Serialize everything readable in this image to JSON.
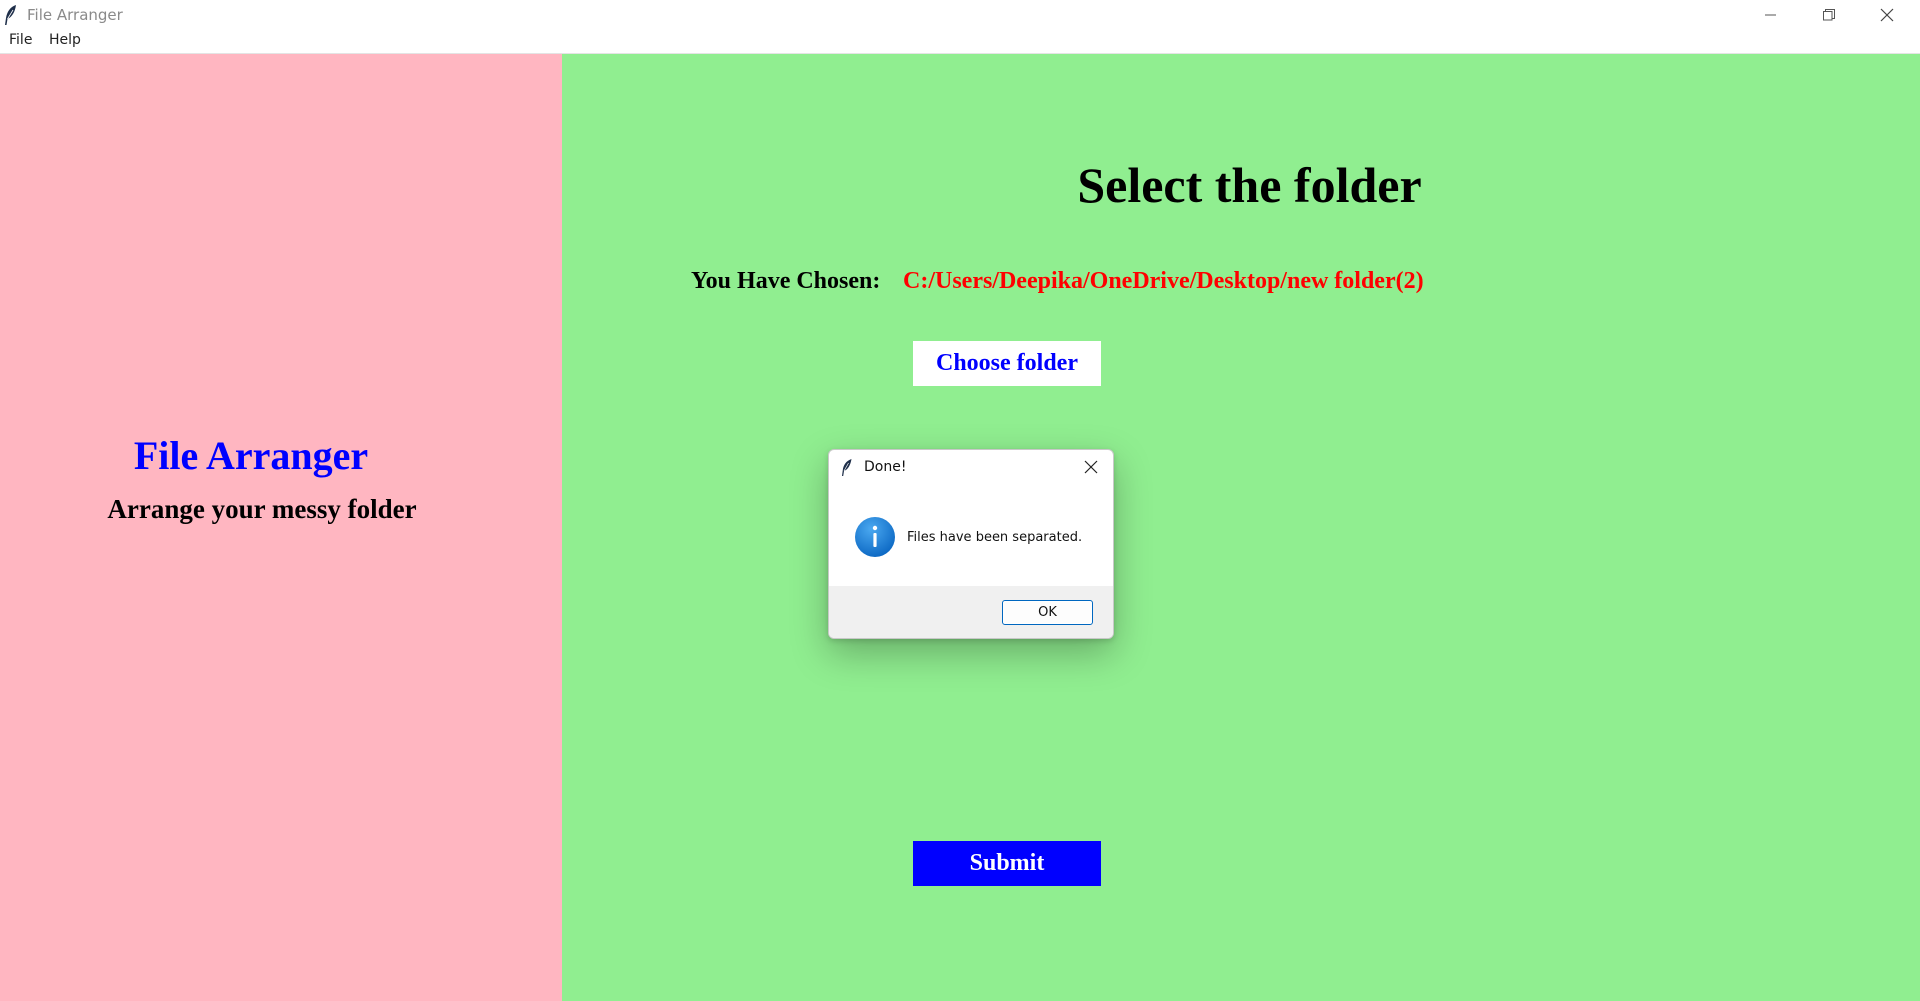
{
  "window": {
    "title": "File Arranger"
  },
  "menu": {
    "items": [
      {
        "label": "File"
      },
      {
        "label": "Help"
      }
    ]
  },
  "left_panel": {
    "title": "File Arranger",
    "subtitle": "Arrange your messy folder"
  },
  "right_panel": {
    "heading": "Select the folder",
    "chosen_label": "You Have Chosen:",
    "chosen_path": "C:/Users/Deepika/OneDrive/Desktop/new folder(2)",
    "choose_button": "Choose folder",
    "submit_button": "Submit"
  },
  "dialog": {
    "title": "Done!",
    "message": "Files have been separated.",
    "ok_button": "OK",
    "icon": "info-icon"
  },
  "colors": {
    "left_panel_bg": "#ffb6c1",
    "right_panel_bg": "#90ee90",
    "accent_blue": "#0000ff",
    "path_red": "#ff0000",
    "info_icon": "#1a7fd4"
  },
  "icons": {
    "app": "feather-icon",
    "minimize": "minimize-icon",
    "maximize": "restore-icon",
    "close": "close-icon"
  }
}
